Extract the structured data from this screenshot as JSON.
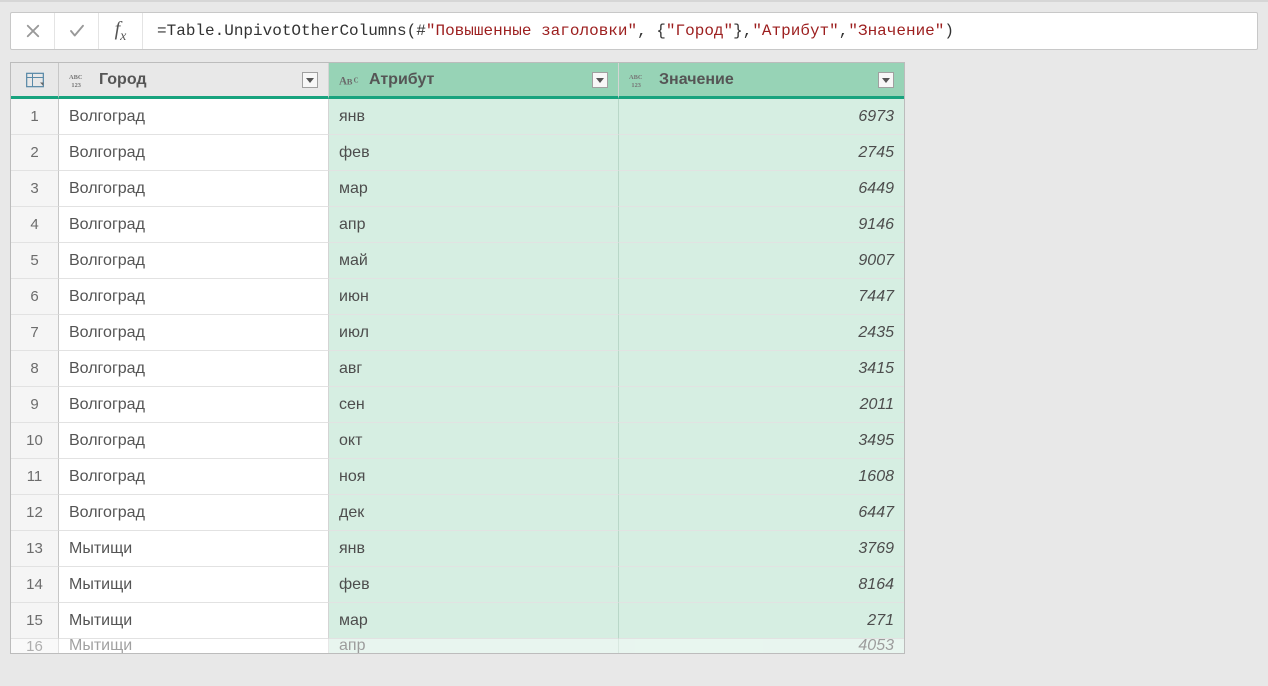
{
  "formula_bar": {
    "prefix": "= ",
    "function_open": "Table.UnpivotOtherColumns(#",
    "arg1": "\"Повышенные заголовки\"",
    "mid1": ", {",
    "arg2": "\"Город\"",
    "mid2": "}, ",
    "arg3": "\"Атрибут\"",
    "mid3": ", ",
    "arg4": "\"Значение\"",
    "close": ")"
  },
  "columns": [
    {
      "name": "Город",
      "type": "any"
    },
    {
      "name": "Атрибут",
      "type": "text",
      "selected": true
    },
    {
      "name": "Значение",
      "type": "any",
      "selected": true
    }
  ],
  "rows": [
    {
      "n": "1",
      "city": "Волгоград",
      "attr": "янв",
      "val": "6973"
    },
    {
      "n": "2",
      "city": "Волгоград",
      "attr": "фев",
      "val": "2745"
    },
    {
      "n": "3",
      "city": "Волгоград",
      "attr": "мар",
      "val": "6449"
    },
    {
      "n": "4",
      "city": "Волгоград",
      "attr": "апр",
      "val": "9146"
    },
    {
      "n": "5",
      "city": "Волгоград",
      "attr": "май",
      "val": "9007"
    },
    {
      "n": "6",
      "city": "Волгоград",
      "attr": "июн",
      "val": "7447"
    },
    {
      "n": "7",
      "city": "Волгоград",
      "attr": "июл",
      "val": "2435"
    },
    {
      "n": "8",
      "city": "Волгоград",
      "attr": "авг",
      "val": "3415"
    },
    {
      "n": "9",
      "city": "Волгоград",
      "attr": "сен",
      "val": "2011"
    },
    {
      "n": "10",
      "city": "Волгоград",
      "attr": "окт",
      "val": "3495"
    },
    {
      "n": "11",
      "city": "Волгоград",
      "attr": "ноя",
      "val": "1608"
    },
    {
      "n": "12",
      "city": "Волгоград",
      "attr": "дек",
      "val": "6447"
    },
    {
      "n": "13",
      "city": "Мытищи",
      "attr": "янв",
      "val": "3769"
    },
    {
      "n": "14",
      "city": "Мытищи",
      "attr": "фев",
      "val": "8164"
    },
    {
      "n": "15",
      "city": "Мытищи",
      "attr": "мар",
      "val": "271"
    }
  ],
  "partial_row": {
    "n": "16",
    "city": "Мытищи",
    "attr": "апр",
    "val": "4053"
  }
}
